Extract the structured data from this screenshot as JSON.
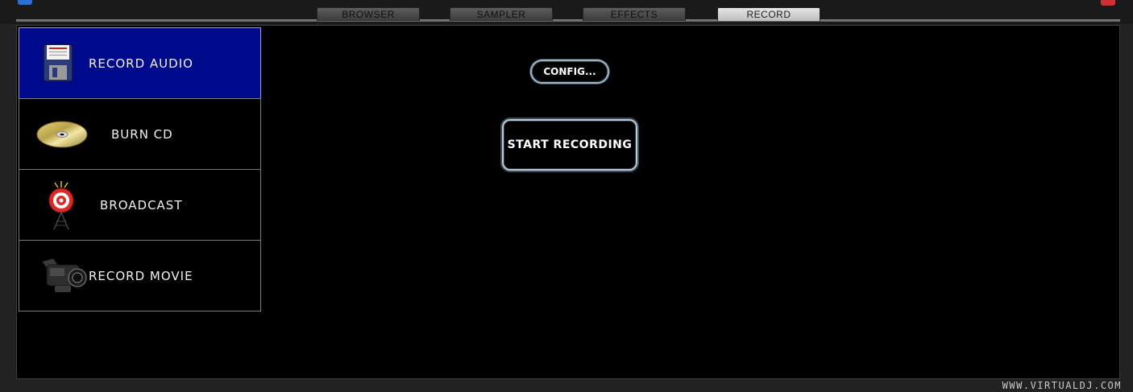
{
  "tabs": [
    {
      "label": "BROWSER",
      "active": false
    },
    {
      "label": "SAMPLER",
      "active": false
    },
    {
      "label": "EFFECTS",
      "active": false
    },
    {
      "label": "RECORD",
      "active": true
    }
  ],
  "menu": {
    "items": [
      {
        "label": "RECORD AUDIO",
        "icon": "floppy-disk-icon",
        "active": true
      },
      {
        "label": "BURN CD",
        "icon": "cd-disc-icon",
        "active": false
      },
      {
        "label": "BROADCAST",
        "icon": "broadcast-antenna-icon",
        "active": false
      },
      {
        "label": "RECORD MOVIE",
        "icon": "video-camera-icon",
        "active": false
      }
    ]
  },
  "buttons": {
    "config_label": "CONFIG...",
    "start_label": "START RECORDING"
  },
  "footer": {
    "url": "WWW.VIRTUALDJ.COM"
  },
  "colors": {
    "active_menu_bg": "#000a8e",
    "panel_bg": "#000000",
    "active_tab": "#d8d8d8"
  }
}
